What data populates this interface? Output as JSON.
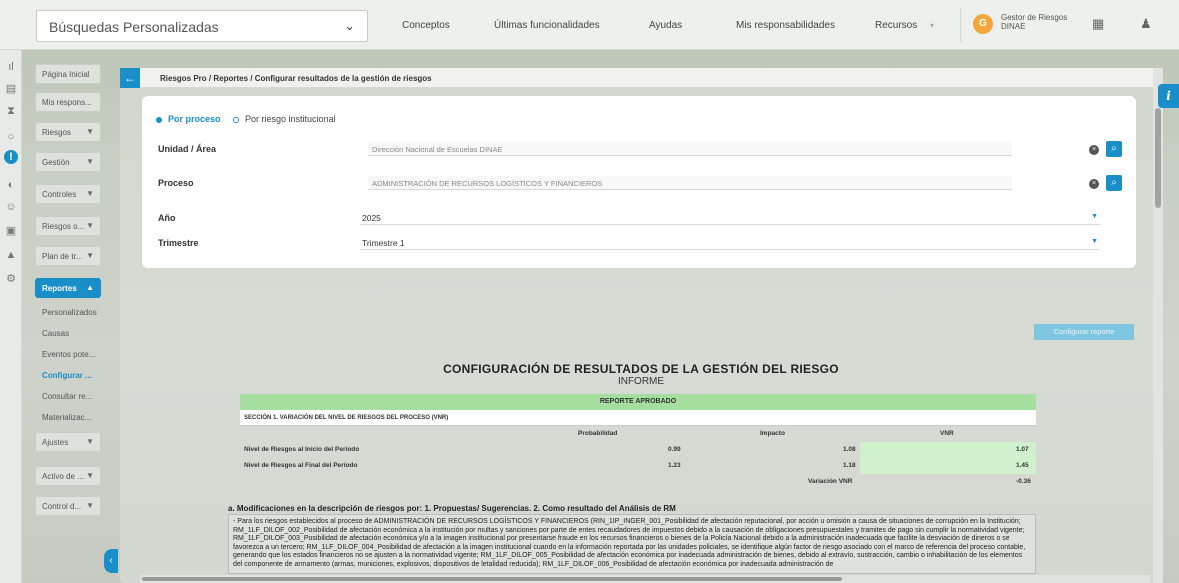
{
  "topbar": {
    "search_label": "Búsquedas Personalizadas",
    "nav": [
      "Conceptos",
      "Últimas funcionalidades",
      "Ayudas",
      "Mis responsabilidades",
      "Recursos"
    ],
    "user_initial": "G",
    "user_name": "Gestor de Riesgos DINAE"
  },
  "sidebar": {
    "items": [
      {
        "label": "Página Inicial"
      },
      {
        "label": "Mis respons..."
      },
      {
        "label": "Riesgos"
      },
      {
        "label": "Gestión"
      },
      {
        "label": "Controles"
      },
      {
        "label": "Riesgos o..."
      },
      {
        "label": "Plan de tr..."
      },
      {
        "label": "Reportes"
      }
    ],
    "subitems": [
      "Personalizados",
      "Causas",
      "Eventos pote...",
      "Configurar ...",
      "Consultar re...",
      "Materializac..."
    ],
    "items_after": [
      "Ajustes",
      "Activo de ...",
      "Control d..."
    ]
  },
  "breadcrumb": "Riesgos Pro / Reportes / Configurar resultados de la gestión de riesgos",
  "form": {
    "radio_process": "Por proceso",
    "radio_institutional": "Por riesgo institucional",
    "unidad_label": "Unidad / Área",
    "unidad_value": "Dirección Nacional de Escuelas DINAE",
    "proceso_label": "Proceso",
    "proceso_value": "ADMINISTRACIÓN DE RECURSOS LOGÍSTICOS Y FINANCIEROS",
    "anio_label": "Año",
    "anio_value": "2025",
    "trimestre_label": "Trimestre",
    "trimestre_value": "Trimestre 1"
  },
  "config_button": "Configurar reporte",
  "report": {
    "title": "CONFIGURACIÓN DE RESULTADOS DE LA GESTIÓN DEL RIESGO",
    "subtitle": "INFORME",
    "approved": "REPORTE APROBADO",
    "section1": "SECCIÓN 1. VARIACIÓN DEL NIVEL DE RIESGOS DEL PROCESO (VNR)",
    "col_prob": "Probabilidad",
    "col_impact": "Impacto",
    "col_vnr": "VNR",
    "row1_label": "Nivel de Riesgos al Inicio del Período",
    "row1_prob": "0.99",
    "row1_impact": "1.08",
    "row1_vnr": "1.07",
    "row2_label": "Nivel de Riesgos al Final del Período",
    "row2_prob": "1.23",
    "row2_impact": "1.18",
    "row2_vnr": "1.45",
    "variation_label": "Variación VNR",
    "variation_value": "-0.36",
    "mods_title": "a. Modificaciones en la descripción de riesgos por: 1. Propuestas/ Sugerencias. 2. Como resultado del Análisis de RM",
    "mods_text": "- Para los riesgos establecidos al proceso de ADMINISTRACIÓN DE RECURSOS LOGÍSTICOS Y FINANCIEROS (RIN_1IP_INGER_001_Posibilidad de afectación reputacional, por acción u omisión a causa de situaciones de corrupción en la Institución; RM_1LF_DILOF_002_Posibilidad de afectación económica a la institución por multas y sanciones por parte de entes recaudadores de impuestos debido a la causación de obligaciones presupuestales y tramites de pago sin cumplir la normatividad vigente; RM_1LF_DILOF_003_Posibilidad de afectación económica y/o a la imagen institucional por presentarse fraude en los recursos financieros o bienes de la Policía Nacional debido a la administración inadecuada que facilite la desviación de dineros o se favorezca a un tercero; RM_1LF_DILOF_004_Posibilidad de afectación a la imagen institucional cuando en la información reportada por las unidades policiales, se identifique algún factor de riesgo asociado con el marco de referencia del proceso contable, generando que los estados financieros no se ajusten a la normatividad vigente; RM_1LF_DILOF_005_Posibilidad de afectación económica por inadecuada administración de bienes, debido al extravío, sustracción, cambio o inhabilitación de los elementos del componente de armamento (armas, municiones, explosivos, dispositivos de letalidad reducida); RM_1LF_DILOF_006_Posibilidad de afectación económica por inadecuada administración de"
  }
}
